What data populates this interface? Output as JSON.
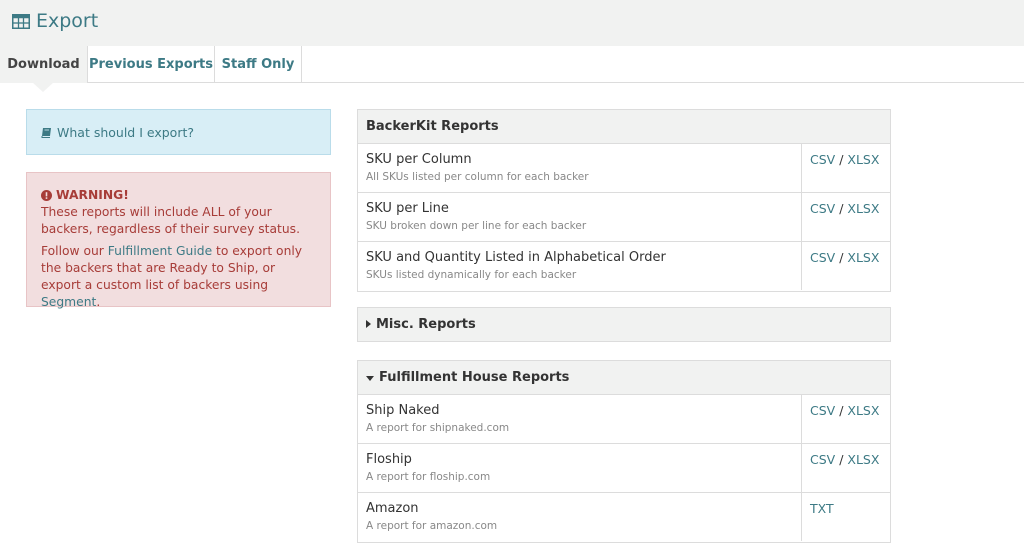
{
  "header": {
    "title": "Export"
  },
  "tabs": [
    {
      "label": "Download"
    },
    {
      "label": "Previous Exports"
    },
    {
      "label": "Staff Only"
    }
  ],
  "info": {
    "text": "What should I export?"
  },
  "warning": {
    "title": "WARNING!",
    "p1": "These reports will include ALL of your backers, regardless of their survey status.",
    "p2_before": "Follow our ",
    "p2_link1": "Fulfillment Guide",
    "p2_middle": " to export only the backers that are Ready to Ship, or export a custom list of backers using ",
    "p2_link2": "Segment",
    "p2_after": "."
  },
  "backerkit": {
    "title": "BackerKit Reports",
    "rows": [
      {
        "name": "SKU per Column",
        "desc": "All SKUs listed per column for each backer",
        "link1": "CSV",
        "sep": " / ",
        "link2": "XLSX"
      },
      {
        "name": "SKU per Line",
        "desc": "SKU broken down per line for each backer",
        "link1": "CSV",
        "sep": " / ",
        "link2": "XLSX"
      },
      {
        "name": "SKU and Quantity Listed in Alphabetical Order",
        "desc": "SKUs listed dynamically for each backer",
        "link1": "CSV",
        "sep": " / ",
        "link2": "XLSX"
      }
    ]
  },
  "misc": {
    "title": "Misc. Reports"
  },
  "fulfillment": {
    "title": "Fulfillment House Reports",
    "rows": [
      {
        "name": "Ship Naked",
        "desc": "A report for shipnaked.com",
        "link1": "CSV",
        "sep": " / ",
        "link2": "XLSX"
      },
      {
        "name": "Floship",
        "desc": "A report for floship.com",
        "link1": "CSV",
        "sep": " / ",
        "link2": "XLSX"
      },
      {
        "name": "Amazon",
        "desc": "A report for amazon.com",
        "link1": "TXT"
      }
    ]
  },
  "colors": {
    "accent": "#3d7a85",
    "warning_text": "#a73c38",
    "warning_bg": "#f2dedf",
    "info_bg": "#d8eef6"
  },
  "icons": {
    "header": "table-icon",
    "info": "book-icon",
    "warning": "exclamation-circle-icon",
    "collapsed": "caret-right-icon",
    "expanded": "caret-down-icon"
  }
}
